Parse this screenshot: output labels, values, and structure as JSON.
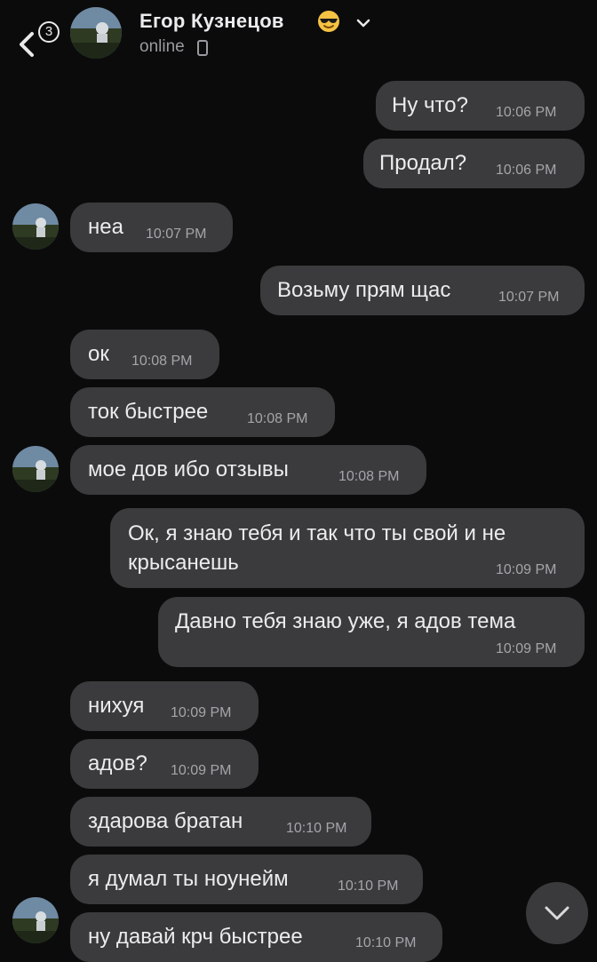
{
  "header": {
    "unread_count": "3",
    "contact_name": "Егор Кузнецов",
    "status": "online",
    "name_emoji": "sunglasses-emoji-icon"
  },
  "messages": [
    {
      "side": "out",
      "text": "Ну что?",
      "time": "10:06 PM"
    },
    {
      "side": "out",
      "text": "Продал?",
      "time": "10:06 PM"
    },
    {
      "side": "in",
      "text": "неа",
      "time": "10:07 PM"
    },
    {
      "side": "out",
      "text": "Возьму прям щас",
      "time": "10:07 PM"
    },
    {
      "side": "in",
      "text": "ок",
      "time": "10:08 PM"
    },
    {
      "side": "in",
      "text": "ток быстрее",
      "time": "10:08 PM"
    },
    {
      "side": "in",
      "text": "мое дов ибо отзывы",
      "time": "10:08 PM"
    },
    {
      "side": "out",
      "text_line1": "Ок, я знаю тебя и так что ты свой и не",
      "text_line2": "крысанешь",
      "time": "10:09 PM"
    },
    {
      "side": "out",
      "text": "Давно тебя знаю уже, я адов тема",
      "time": "10:09 PM"
    },
    {
      "side": "in",
      "text": "нихуя",
      "time": "10:09 PM"
    },
    {
      "side": "in",
      "text": "адов?",
      "time": "10:09 PM"
    },
    {
      "side": "in",
      "text": "здарова братан",
      "time": "10:10 PM"
    },
    {
      "side": "in",
      "text": "я думал ты ноунейм",
      "time": "10:10 PM"
    },
    {
      "side": "in",
      "text": "ну давай крч быстрее",
      "time": "10:10 PM"
    }
  ],
  "colors": {
    "background": "#0b0b0c",
    "bubble": "#3b3b3d",
    "text": "#ececee",
    "time": "#a5a5aa"
  }
}
